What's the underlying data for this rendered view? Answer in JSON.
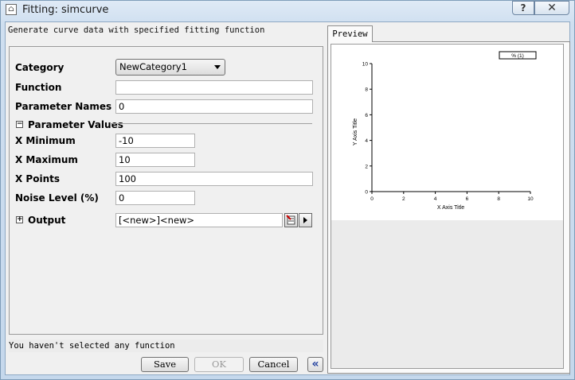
{
  "window": {
    "title": "Fitting: simcurve",
    "help_label": "?",
    "close_label": "✕"
  },
  "description": "Generate curve data with specified fitting function",
  "form": {
    "category_label": "Category",
    "category_value": "NewCategory1",
    "function_label": "Function",
    "function_value": "",
    "param_names_label": "Parameter Names",
    "param_names_value": "0",
    "param_values_label": "Parameter Values",
    "xmin_label": "X Minimum",
    "xmin_value": "-10",
    "xmax_label": "X Maximum",
    "xmax_value": "10",
    "xpoints_label": "X Points",
    "xpoints_value": "100",
    "noise_label": "Noise Level (%)",
    "noise_value": "0",
    "output_label": "Output",
    "output_value": "[<new>]<new>"
  },
  "status_text": "You haven't selected any function",
  "buttons": {
    "save": "Save",
    "ok": "OK",
    "cancel": "Cancel",
    "collapse": "«"
  },
  "preview": {
    "tab_label": "Preview",
    "legend_label": "% (1)",
    "x_axis_title": "X Axis Title",
    "y_axis_title": "Y Axis Title",
    "x_ticks": [
      "0",
      "2",
      "4",
      "6",
      "8",
      "10"
    ],
    "y_ticks": [
      "0",
      "2",
      "4",
      "6",
      "8",
      "10"
    ]
  },
  "icons": {
    "app": "app-icon",
    "pick_range": "range-picker-icon",
    "menu": "triangle-right-icon"
  }
}
